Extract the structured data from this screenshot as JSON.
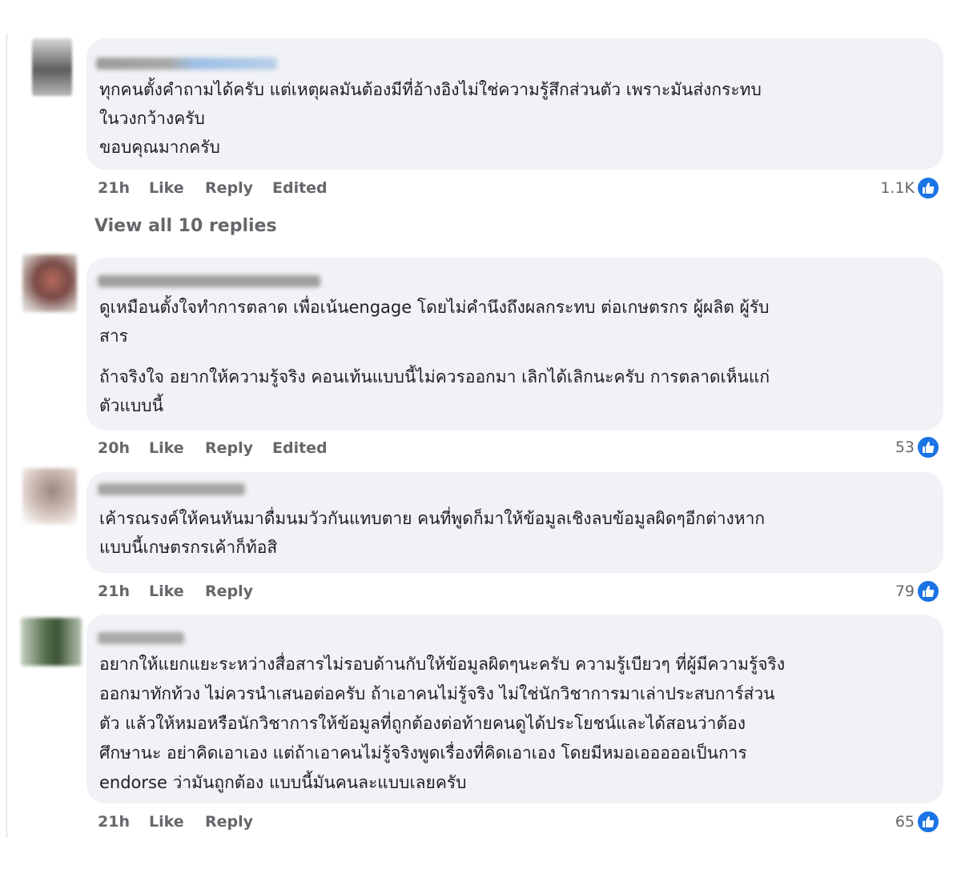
{
  "comments": [
    {
      "text": "ทุกคนตั้งคำถามได้ครับ แต่เหตุผลมันต้องมีที่อ้างอิงไม่ใช่ความรู้สึกส่วนตัว เพราะมันส่งกระทบ\nในวงกว้างครับ\nขอบคุณมากครับ",
      "time": "21h",
      "like": "Like",
      "reply": "Reply",
      "edited": "Edited",
      "reactions": "1.1K"
    },
    {
      "text": "ดูเหมือนตั้งใจทำการตลาด เพื่อเน้นengage โดยไม่คำนึงถึงผลกระทบ ต่อเกษตรกร ผู้ผลิต ผู้รับ\nสาร",
      "text2": "ถ้าจริงใจ อยากให้ความรู้จริง คอนเท้นแบบนี้ไม่ควรออกมา เลิกได้เลิกนะครับ การตลาดเห็นแก่\nตัวแบบนี้",
      "time": "20h",
      "like": "Like",
      "reply": "Reply",
      "edited": "Edited",
      "reactions": "53"
    },
    {
      "text": "เค้ารณรงค์ให้คนหันมาดื่มนมวัวกันแทบตาย คนที่พูดก็มาให้ข้อมูลเชิงลบข้อมูลผิดๆอีกต่างหาก\nแบบนี้เกษตรกรเค้าก็ท้อสิ",
      "time": "21h",
      "like": "Like",
      "reply": "Reply",
      "reactions": "79"
    },
    {
      "text": "อยากให้แยกแยะระหว่างสื่อสารไม่รอบด้านกับให้ข้อมูลผิดๆนะครับ ความรู้เบียวๆ ที่ผู้มีความรู้จริง\nออกมาทักท้วง ไม่ควรนำเสนอต่อครับ ถ้าเอาคนไม่รู้จริง ไม่ใช่นักวิชาการมาเล่าประสบการ์ส่วน\nตัว แล้วให้หมอหรือนักวิชาการให้ข้อมูลที่ถูกต้องต่อท้ายคนดูได้ประโยชน์และได้สอนว่าต้อง\nศึกษานะ อย่าคิดเอาเอง แต่ถ้าเอาคนไม่รู้จริงพูดเรื่องที่คิดเอาเอง โดยมีหมอเอออออเป็นการ\nendorse ว่ามันถูกต้อง แบบนี้มันคนละแบบเลยครับ",
      "time": "21h",
      "like": "Like",
      "reply": "Reply",
      "reactions": "65"
    }
  ],
  "view_replies": "View all 10 replies",
  "colors": {
    "bubble": "#f0f2f5",
    "meta_text": "#65676b",
    "like_blue": "#1b74e4"
  },
  "icons": {
    "reaction": "like-thumb-icon"
  }
}
